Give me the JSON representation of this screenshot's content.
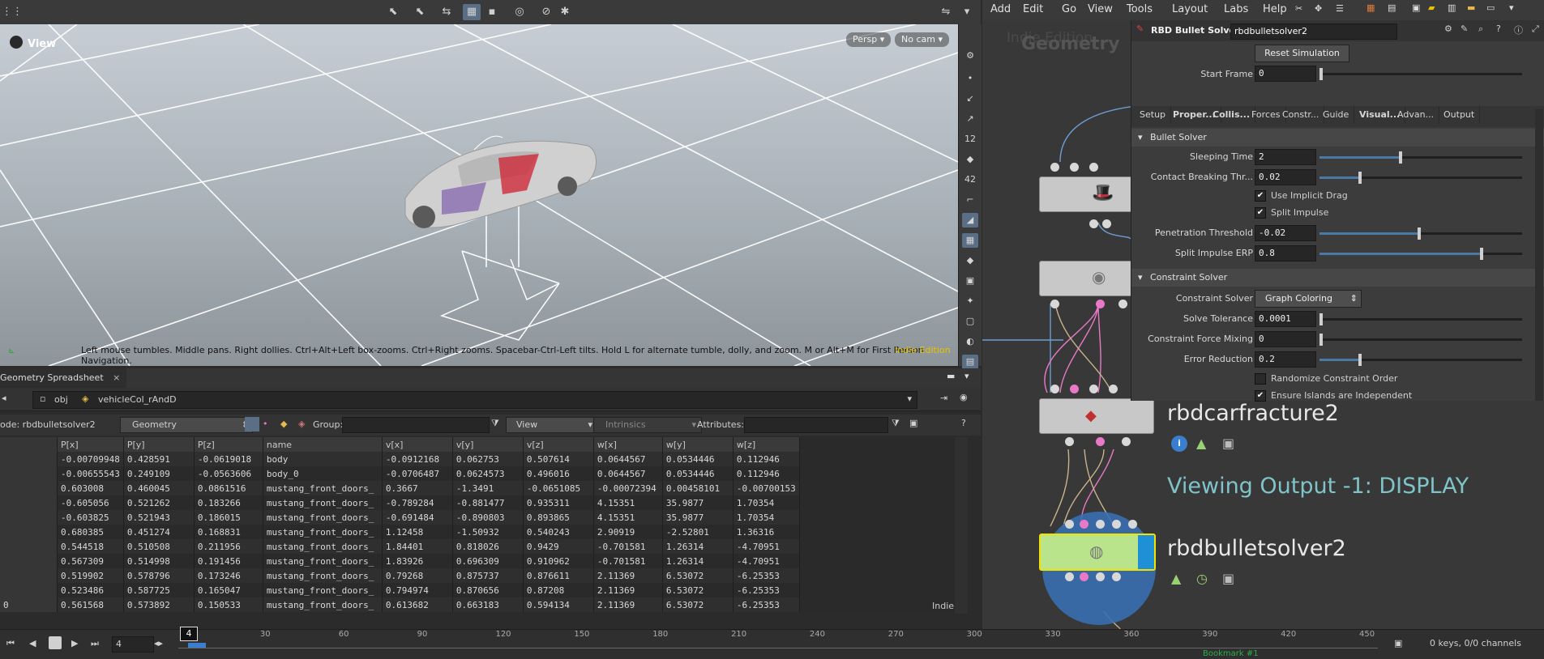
{
  "viewport": {
    "title": "View",
    "persp_label": "Persp",
    "cam_label": "No cam",
    "hint": "Left mouse tumbles. Middle pans. Right dollies. Ctrl+Alt+Left box-zooms. Ctrl+Right zooms. Spacebar-Ctrl-Left tilts. Hold L for alternate tumble, dolly, and zoom. M or Alt+M for First Person Navigation.",
    "watermark": "Indie Edition"
  },
  "spreadsheet": {
    "tab_label": "Geometry Spreadsheet",
    "path_obj": "obj",
    "path_node": "vehicleCol_rAndD",
    "node_label": "ode: rbdbulletsolver2",
    "context": "Geometry",
    "group_label": "Group:",
    "view_label": "View",
    "intrinsics_label": "Intrinsics",
    "attributes_label": "Attributes:",
    "columns": [
      "P[x]",
      "P[y]",
      "P[z]",
      "name",
      "v[x]",
      "v[y]",
      "v[z]",
      "w[x]",
      "w[y]",
      "w[z]"
    ],
    "rows": [
      [
        "-0.00709948",
        "0.428591",
        "-0.0619018",
        "body",
        "-0.0912168",
        "0.062753",
        "0.507614",
        "0.0644567",
        "0.0534446",
        "0.112946"
      ],
      [
        "-0.00655543",
        "0.249109",
        "-0.0563606",
        "body_0",
        "-0.0706487",
        "0.0624573",
        "0.496016",
        "0.0644567",
        "0.0534446",
        "0.112946"
      ],
      [
        "0.603008",
        "0.460045",
        "0.0861516",
        "mustang_front_doors_",
        "0.3667",
        "-1.3491",
        "-0.0651085",
        "-0.00072394",
        "0.00458101",
        "-0.00700153"
      ],
      [
        "-0.605056",
        "0.521262",
        "0.183266",
        "mustang_front_doors_",
        "-0.789284",
        "-0.881477",
        "0.935311",
        "4.15351",
        "35.9877",
        "1.70354"
      ],
      [
        "-0.603825",
        "0.521943",
        "0.186015",
        "mustang_front_doors_",
        "-0.691484",
        "-0.890803",
        "0.893865",
        "4.15351",
        "35.9877",
        "1.70354"
      ],
      [
        "0.680385",
        "0.451274",
        "0.168831",
        "mustang_front_doors_",
        "1.12458",
        "-1.50932",
        "0.540243",
        "2.90919",
        "-2.52801",
        "1.36316"
      ],
      [
        "0.544518",
        "0.510508",
        "0.211956",
        "mustang_front_doors_",
        "1.84401",
        "0.818026",
        "0.9429",
        "-0.701581",
        "1.26314",
        "-4.70951"
      ],
      [
        "0.567309",
        "0.514998",
        "0.191456",
        "mustang_front_doors_",
        "1.83926",
        "0.696309",
        "0.910962",
        "-0.701581",
        "1.26314",
        "-4.70951"
      ],
      [
        "0.519902",
        "0.578796",
        "0.173246",
        "mustang_front_doors_",
        "0.79268",
        "0.875737",
        "0.876611",
        "2.11369",
        "6.53072",
        "-6.25353"
      ],
      [
        "0.523486",
        "0.587725",
        "0.165047",
        "mustang_front_doors_",
        "0.794974",
        "0.870656",
        "0.87208",
        "2.11369",
        "6.53072",
        "-6.25353"
      ],
      [
        "0.561568",
        "0.573892",
        "0.150533",
        "mustang_front_doors_",
        "0.613682",
        "0.663183",
        "0.594134",
        "2.11369",
        "6.53072",
        "-6.25353"
      ]
    ],
    "last_row_index": "0",
    "footer": "Indie"
  },
  "timeline": {
    "frame": "4",
    "current": "4",
    "ticks": [
      "30",
      "60",
      "90",
      "120",
      "150",
      "180",
      "210",
      "240",
      "270",
      "300",
      "330",
      "360",
      "390",
      "420",
      "450"
    ],
    "bookmark": "Bookmark #1",
    "keys": "0 keys, 0/0 channels"
  },
  "menubar": [
    "Add",
    "Edit",
    "Go",
    "View",
    "Tools",
    "Layout",
    "Labs",
    "Help"
  ],
  "network": {
    "bg_text_1": "Indie Edition",
    "bg_text_2": "Geometry",
    "node_fracture": "rbdcarfracture2",
    "viewing": "Viewing Output -1: DISPLAY",
    "node_solver": "rbdbulletsolver2"
  },
  "params": {
    "node_type": "RBD Bullet Solver",
    "node_name": "rbdbulletsolver2",
    "reset_button": "Reset Simulation",
    "start_frame_label": "Start Frame",
    "start_frame": "0",
    "tabs": [
      "Setup",
      "Proper...",
      "Collis...",
      "Forces",
      "Constr...",
      "Guide",
      "Visual...",
      "Advan...",
      "Output"
    ],
    "bullet_section": "Bullet Solver",
    "sleeping_time_label": "Sleeping Time",
    "sleeping_time": "2",
    "sleeping_time_level": 0.4,
    "contact_label": "Contact Breaking Thr...",
    "contact": "0.02",
    "contact_level": 0.2,
    "implicit_drag": "Use Implicit Drag",
    "split_impulse": "Split Impulse",
    "penetration_label": "Penetration Threshold",
    "penetration": "-0.02",
    "penetration_level": 0.49,
    "erp_label": "Split Impulse ERP",
    "erp": "0.8",
    "erp_level": 0.8,
    "constraint_section": "Constraint Solver",
    "cs_label": "Constraint Solver",
    "cs_value": "Graph Coloring",
    "tolerance_label": "Solve Tolerance",
    "tolerance": "0.0001",
    "cfm_label": "Constraint Force Mixing",
    "cfm": "0",
    "error_label": "Error Reduction",
    "error": "0.2",
    "error_level": 0.2,
    "randomize": "Randomize Constraint Order",
    "islands": "Ensure Islands are Independent"
  },
  "colors": {
    "accent": "#4b79a5",
    "pink_wire": "#e879c6",
    "selected_node": "#b9e48b",
    "viewing_text": "#7fc4c8"
  }
}
